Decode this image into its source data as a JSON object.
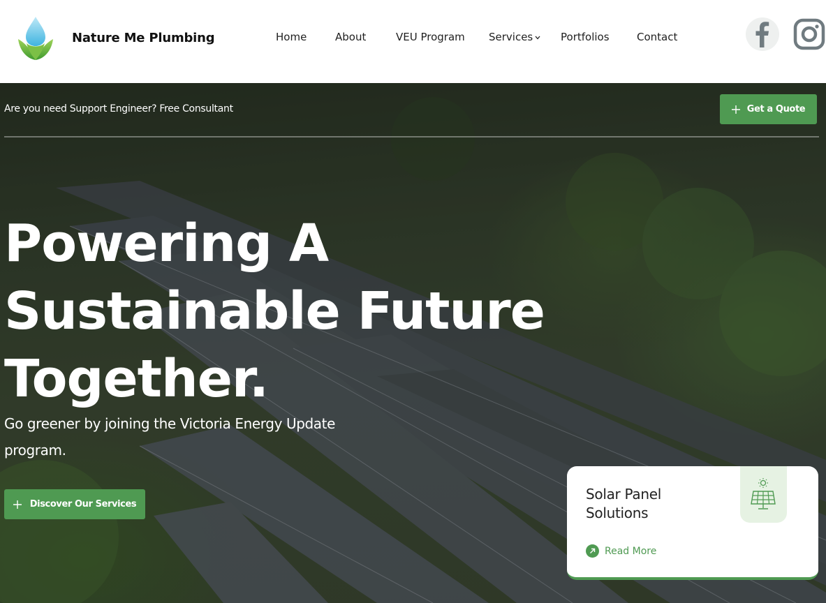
{
  "brand": {
    "name": "Nature Me Plumbing",
    "logo_icon": "water-drop-leaf-logo"
  },
  "nav": {
    "items": [
      {
        "label": "Home"
      },
      {
        "label": "About"
      },
      {
        "label": "VEU Program"
      },
      {
        "label": "Services",
        "has_dropdown": true
      },
      {
        "label": "Portfolios"
      },
      {
        "label": "Contact"
      }
    ]
  },
  "social": {
    "facebook_icon": "facebook-icon",
    "instagram_icon": "instagram-icon"
  },
  "topbar": {
    "text": "Are you need Support Engineer? Free Consultant",
    "quote_label": "Get a Quote"
  },
  "hero": {
    "headline_lines": [
      "Powering A",
      "Sustainable Future",
      "Together."
    ],
    "subtitle": "Go greener by joining the Victoria Energy Update program.",
    "cta_label": "Discover Our Services"
  },
  "card": {
    "title": "Solar Panel Solutions",
    "icon": "solar-panel-icon",
    "read_more_label": "Read More"
  },
  "colors": {
    "accent": "#4f9a52",
    "card_icon_bg": "#e6f2e3"
  }
}
